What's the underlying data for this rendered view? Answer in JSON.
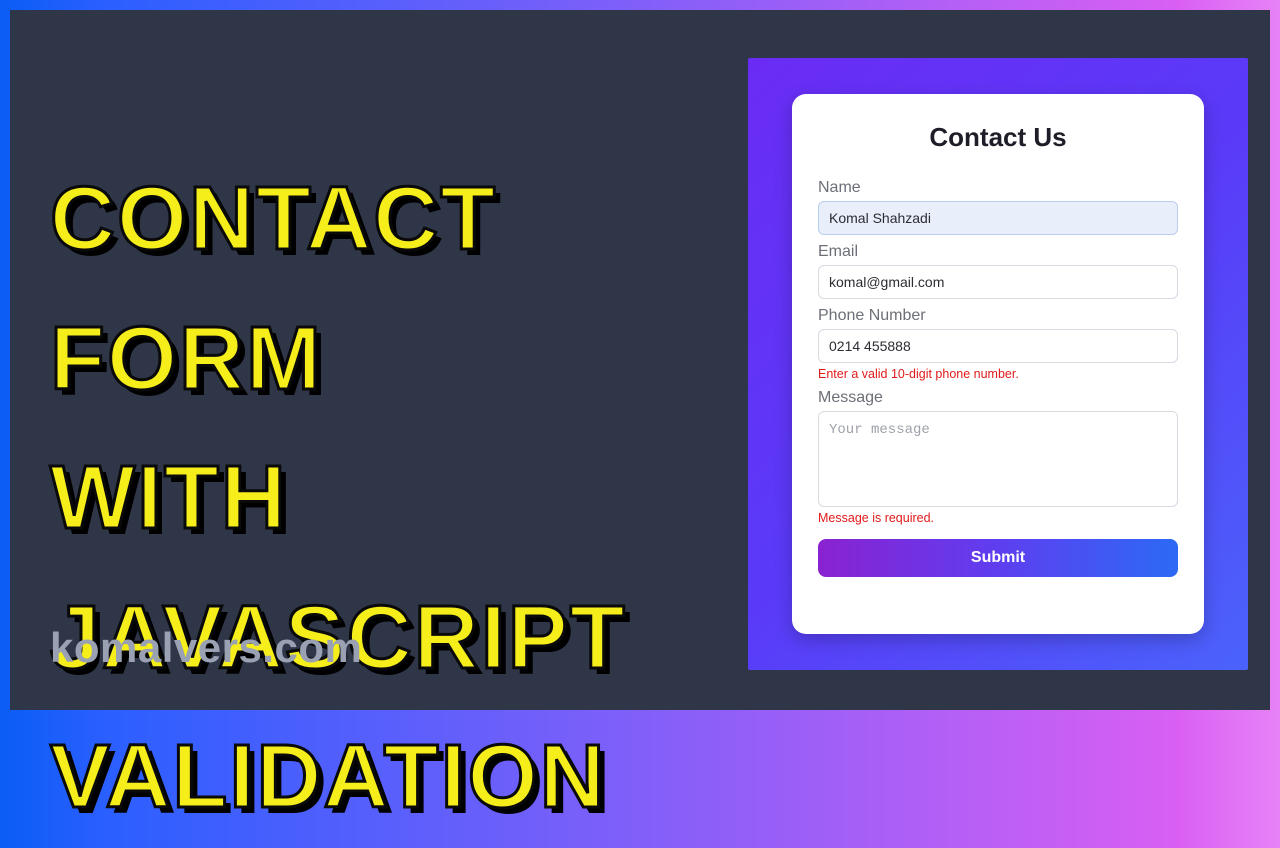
{
  "headline": {
    "line1": "CONTACT FORM",
    "line2": "WITH JAVASCRIPT",
    "line3": "VALIDATION"
  },
  "site": "komalvers.com",
  "form": {
    "title": "Contact Us",
    "name": {
      "label": "Name",
      "value": "Komal Shahzadi"
    },
    "email": {
      "label": "Email",
      "value": "komal@gmail.com"
    },
    "phone": {
      "label": "Phone Number",
      "value": "0214 455888",
      "error": "Enter a valid 10-digit phone number."
    },
    "message": {
      "label": "Message",
      "placeholder": "Your message",
      "value": "",
      "error": "Message is required."
    },
    "submit": "Submit"
  }
}
